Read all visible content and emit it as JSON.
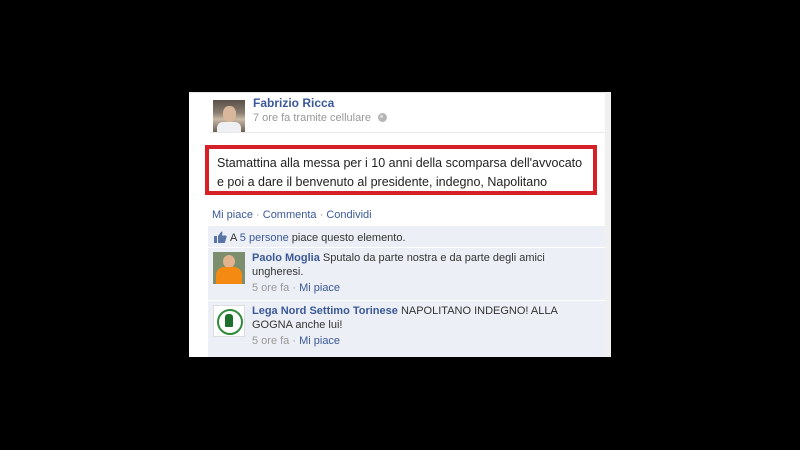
{
  "post": {
    "author": "Fabrizio Ricca",
    "meta": "7 ore fa tramite cellulare",
    "text_line1": "Stamattina alla messa per i 10 anni della scomparsa dell'avvocato",
    "text_line2": "e poi a dare il benvenuto al presidente, indegno, Napolitano"
  },
  "actions": {
    "like": "Mi piace",
    "comment": "Commenta",
    "share": "Condividi",
    "separator": " · "
  },
  "likes": {
    "prefix": "A ",
    "people": "5 persone",
    "suffix": " piace questo elemento."
  },
  "comments": [
    {
      "name": "Paolo Moglia",
      "text": "Sputalo da parte nostra e da parte degli amici ungheresi.",
      "time": "5 ore fa",
      "like": "Mi piace"
    },
    {
      "name": "Lega Nord Settimo Torinese",
      "text": "NAPOLITANO INDEGNO! ALLA GOGNA anche lui!",
      "time": "5 ore fa",
      "like": "Mi piace"
    }
  ],
  "icons": {
    "privacy": "globe-icon",
    "like": "thumbs-up-icon"
  },
  "colors": {
    "link": "#3b5998",
    "highlight_border": "#d42026",
    "comment_bg": "#eceff5"
  }
}
